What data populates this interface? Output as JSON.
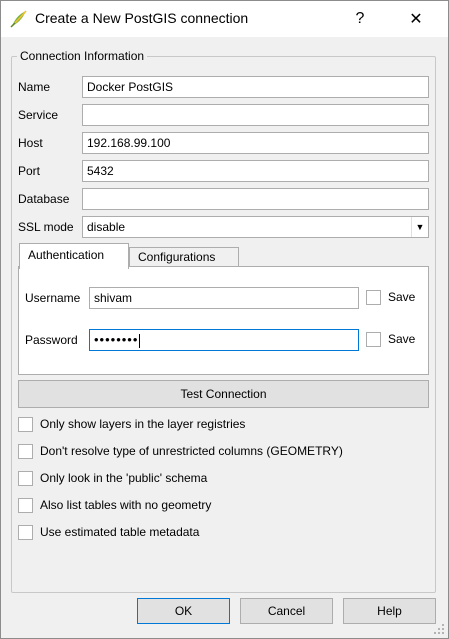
{
  "window": {
    "title": "Create a New PostGIS connection",
    "help_label": "?",
    "close_label": "✕"
  },
  "connection": {
    "group_title": "Connection Information",
    "name_label": "Name",
    "name_value": "Docker PostGIS",
    "service_label": "Service",
    "service_value": "",
    "host_label": "Host",
    "host_value": "192.168.99.100",
    "port_label": "Port",
    "port_value": "5432",
    "database_label": "Database",
    "database_value": "",
    "ssl_label": "SSL mode",
    "ssl_value": "disable"
  },
  "tabs": [
    {
      "label": "Authentication",
      "active": true
    },
    {
      "label": "Configurations",
      "active": false
    }
  ],
  "auth": {
    "username_label": "Username",
    "username_value": "shivam",
    "password_label": "Password",
    "password_value": "••••••••",
    "save_label": "Save"
  },
  "test_button_label": "Test Connection",
  "options": [
    {
      "label": "Only show layers in the layer registries",
      "checked": false
    },
    {
      "label": "Don't resolve type of unrestricted columns (GEOMETRY)",
      "checked": false
    },
    {
      "label": "Only look in the 'public' schema",
      "checked": false
    },
    {
      "label": "Also list tables with no geometry",
      "checked": false
    },
    {
      "label": "Use estimated table metadata",
      "checked": false
    }
  ],
  "buttons": {
    "ok": "OK",
    "cancel": "Cancel",
    "help": "Help"
  },
  "colors": {
    "focus_border": "#0078d7",
    "dialog_bg": "#f0f0f0",
    "icon_green": "#7cb342",
    "icon_yellow": "#f2c12e"
  },
  "icons": [
    "qgis-app-icon",
    "chevron-down-icon",
    "close-icon",
    "resize-grip-icon"
  ]
}
